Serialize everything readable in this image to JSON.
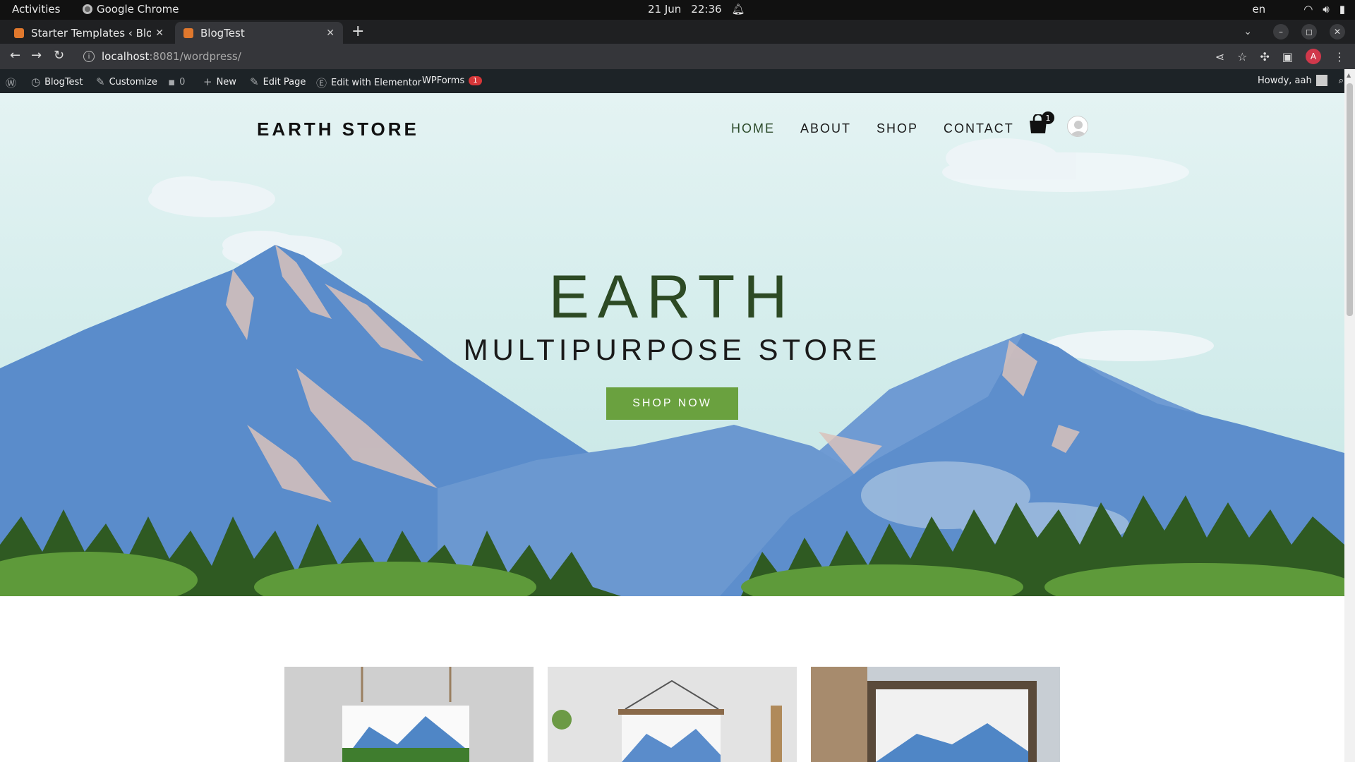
{
  "system": {
    "activities": "Activities",
    "app_name": "Google Chrome",
    "date": "21 Jun",
    "time": "22:36",
    "lang": "en"
  },
  "browser": {
    "tabs": [
      {
        "title": "Starter Templates ‹ BlogTest"
      },
      {
        "title": "BlogTest"
      }
    ],
    "url_host": "localhost",
    "url_path": ":8081/wordpress/",
    "profile_initial": "A"
  },
  "wpadmin": {
    "site": "BlogTest",
    "customize": "Customize",
    "comments": "0",
    "new": "New",
    "edit_page": "Edit Page",
    "elementor": "Edit with Elementor",
    "wpforms": "WPForms",
    "wpforms_badge": "1",
    "howdy": "Howdy, aah"
  },
  "site": {
    "logo": "EARTH STORE",
    "menu": [
      "HOME",
      "ABOUT",
      "SHOP",
      "CONTACT"
    ],
    "cart_count": "1",
    "hero_title": "EARTH",
    "hero_subtitle": "MULTIPURPOSE STORE",
    "cta": "SHOP NOW"
  },
  "colors": {
    "accent_green": "#6aa13f",
    "title_green": "#2d4a24",
    "mountain_blue": "#5a8ccb"
  }
}
